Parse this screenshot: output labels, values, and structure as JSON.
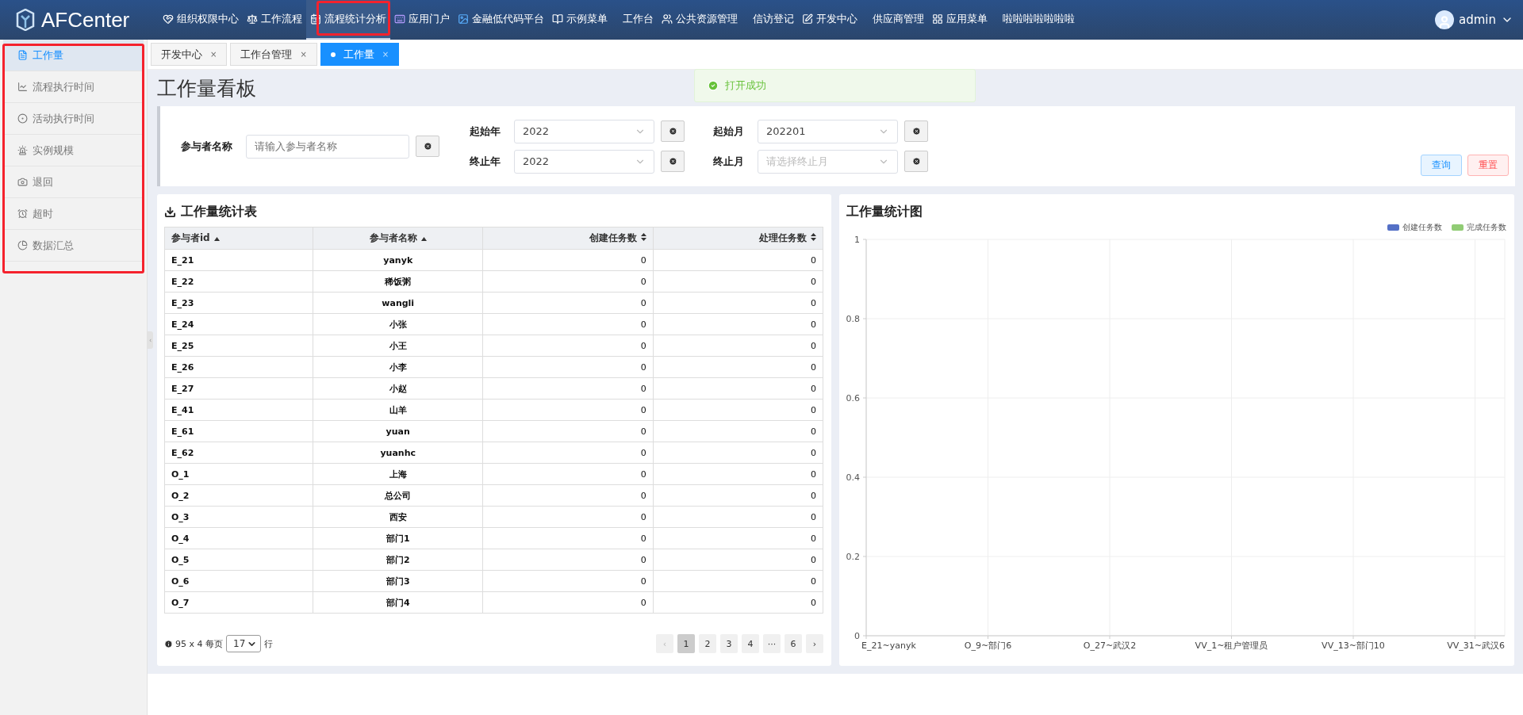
{
  "app": {
    "logo": "AFCenter"
  },
  "nav": [
    {
      "label": "组织权限中心",
      "selected": false
    },
    {
      "label": "工作流程",
      "selected": false
    },
    {
      "label": "流程统计分析",
      "selected": true
    },
    {
      "label": "应用门户",
      "selected": false
    },
    {
      "label": "金融低代码平台",
      "selected": false
    },
    {
      "label": "示例菜单",
      "selected": false
    },
    {
      "label": "工作台",
      "selected": false
    },
    {
      "label": "公共资源管理",
      "selected": false
    },
    {
      "label": "信访登记",
      "selected": false
    },
    {
      "label": "开发中心",
      "selected": false
    },
    {
      "label": "供应商管理",
      "selected": false
    },
    {
      "label": "应用菜单",
      "selected": false
    },
    {
      "label": "啦啦啦啦啦啦啦",
      "selected": false
    }
  ],
  "user": {
    "name": "admin"
  },
  "sidebar": [
    {
      "label": "工作量",
      "selected": true
    },
    {
      "label": "流程执行时间",
      "selected": false
    },
    {
      "label": "活动执行时间",
      "selected": false
    },
    {
      "label": "实例规模",
      "selected": false
    },
    {
      "label": "退回",
      "selected": false
    },
    {
      "label": "超时",
      "selected": false
    },
    {
      "label": "数据汇总",
      "selected": false
    }
  ],
  "collapse_handle": "‹",
  "tabs": [
    {
      "label": "开发中心",
      "selected": false,
      "close": "×"
    },
    {
      "label": "工作台管理",
      "selected": false,
      "close": "×"
    },
    {
      "label": "工作量",
      "selected": true,
      "close": "×"
    }
  ],
  "page_title": "工作量看板",
  "toast": {
    "text": "打开成功"
  },
  "filters": {
    "participant": {
      "label": "参与者名称",
      "placeholder": "请输入参与者名称"
    },
    "start_year": {
      "label": "起始年",
      "value": "2022"
    },
    "end_year": {
      "label": "终止年",
      "value": "2022"
    },
    "start_month": {
      "label": "起始月",
      "value": "202201"
    },
    "end_month": {
      "label": "终止月",
      "placeholder": "请选择终止月"
    },
    "buttons": [
      {
        "label": "查询",
        "kind": "primary"
      },
      {
        "label": "重置",
        "kind": "danger"
      }
    ]
  },
  "table": {
    "title": "工作量统计表",
    "columns": [
      {
        "label": "参与者id",
        "sorted": true
      },
      {
        "label": "参与者名称",
        "sorted": true
      },
      {
        "label": "创建任务数",
        "sorted": false
      },
      {
        "label": "处理任务数",
        "sorted": false
      }
    ],
    "rows": [
      [
        "E_21",
        "yanyk",
        "0",
        "0"
      ],
      [
        "E_22",
        "稀饭粥",
        "0",
        "0"
      ],
      [
        "E_23",
        "wangli",
        "0",
        "0"
      ],
      [
        "E_24",
        "小张",
        "0",
        "0"
      ],
      [
        "E_25",
        "小王",
        "0",
        "0"
      ],
      [
        "E_26",
        "小李",
        "0",
        "0"
      ],
      [
        "E_27",
        "小赵",
        "0",
        "0"
      ],
      [
        "E_41",
        "山羊",
        "0",
        "0"
      ],
      [
        "E_61",
        "yuan",
        "0",
        "0"
      ],
      [
        "E_62",
        "yuanhc",
        "0",
        "0"
      ],
      [
        "O_1",
        "上海",
        "0",
        "0"
      ],
      [
        "O_2",
        "总公司",
        "0",
        "0"
      ],
      [
        "O_3",
        "西安",
        "0",
        "0"
      ],
      [
        "O_4",
        "部门1",
        "0",
        "0"
      ],
      [
        "O_5",
        "部门2",
        "0",
        "0"
      ],
      [
        "O_6",
        "部门3",
        "0",
        "0"
      ],
      [
        "O_7",
        "部门4",
        "0",
        "0"
      ]
    ]
  },
  "pagination": {
    "summary": "95 x 4 每页",
    "page_size": "17",
    "suffix": "行",
    "pages": [
      {
        "label": "‹",
        "selected": false,
        "disabled": true
      },
      {
        "label": "1",
        "selected": true,
        "disabled": false
      },
      {
        "label": "2",
        "selected": false,
        "disabled": false
      },
      {
        "label": "3",
        "selected": false,
        "disabled": false
      },
      {
        "label": "4",
        "selected": false,
        "disabled": false
      },
      {
        "label": "···",
        "selected": false,
        "disabled": false
      },
      {
        "label": "6",
        "selected": false,
        "disabled": false
      },
      {
        "label": "›",
        "selected": false,
        "disabled": false
      }
    ]
  },
  "chart": {
    "title": "工作量统计图",
    "chart_data": {
      "type": "bar",
      "categories": [
        "E_21~yanyk",
        "O_9~部门6",
        "O_27~武汉2",
        "VV_1~租户管理员",
        "VV_13~部门10",
        "VV_31~武汉6"
      ],
      "series": [
        {
          "name": "创建任务数",
          "color": "#5470c6",
          "values": [
            0,
            0,
            0,
            0,
            0,
            0
          ]
        },
        {
          "name": "完成任务数",
          "color": "#91cc75",
          "values": [
            0,
            0,
            0,
            0,
            0,
            0
          ]
        }
      ],
      "grid": true,
      "ylim": [
        0,
        1
      ],
      "yticks": [
        0,
        0.2,
        0.4,
        0.6,
        0.8,
        1
      ]
    }
  }
}
